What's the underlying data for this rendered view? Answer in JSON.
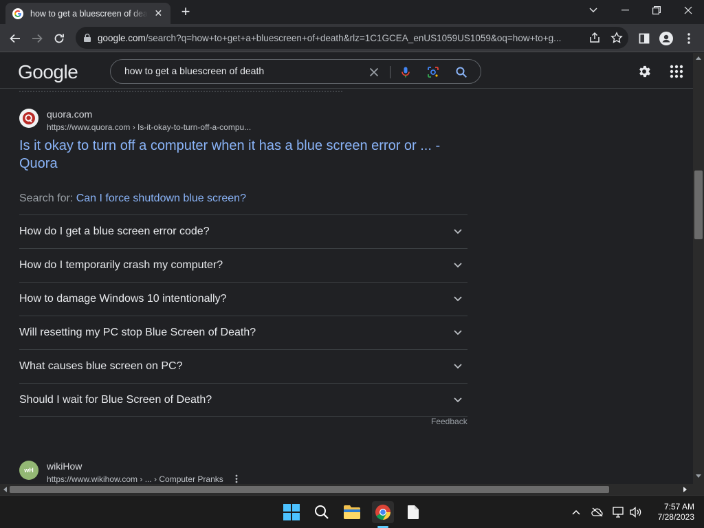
{
  "browser": {
    "tab_title": "how to get a bluescreen of death",
    "url_host": "google.com",
    "url_path": "/search?q=how+to+get+a+bluescreen+of+death&rlz=1C1GCEA_enUS1059US1059&oq=how+to+g..."
  },
  "google": {
    "logo": "Google",
    "query": "how to get a bluescreen of death"
  },
  "result": {
    "site_name": "quora.com",
    "site_url": "https://www.quora.com › Is-it-okay-to-turn-off-a-compu...",
    "title": "Is it okay to turn off a computer when it has a blue screen error or ... - Quora"
  },
  "search_for": {
    "prefix": "Search for:",
    "link": "Can I force shutdown blue screen?"
  },
  "questions": [
    "How do I get a blue screen error code?",
    "How do I temporarily crash my computer?",
    "How to damage Windows 10 intentionally?",
    "Will resetting my PC stop Blue Screen of Death?",
    "What causes blue screen on PC?",
    "Should I wait for Blue Screen of Death?"
  ],
  "feedback": "Feedback",
  "next_result": {
    "site_name": "wikiHow",
    "site_url": "https://www.wikihow.com › ... › Computer Pranks",
    "favicon_text": "wH"
  },
  "clock": {
    "time": "7:57 AM",
    "date": "7/28/2023"
  },
  "colors": {
    "link": "#8ab4f8",
    "background": "#202124",
    "accent": "#60cdff"
  }
}
